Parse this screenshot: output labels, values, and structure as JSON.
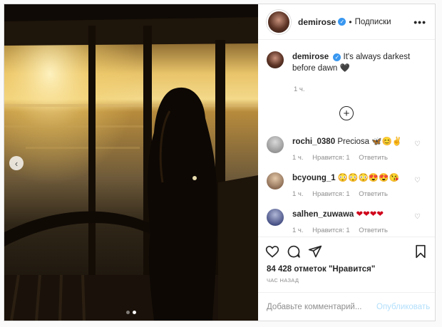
{
  "post": {
    "author": "demirose",
    "follow_label": "Подписки",
    "more_label": "•••",
    "caption": "It's always darkest before dawn",
    "caption_emoji": "🖤",
    "caption_time": "1 ч.",
    "load_more_icon": "plus-circle-icon"
  },
  "comments": [
    {
      "user": "rochi_0380",
      "text": "Preciosa 🦋😊✌",
      "time": "1 ч.",
      "likes": "Нравится: 1",
      "reply": "Ответить",
      "avatar": "gray"
    },
    {
      "user": "bcyoung_1",
      "text": "😳😳😳😍😍😘",
      "time": "1 ч.",
      "likes": "Нравится: 1",
      "reply": "Ответить",
      "avatar": "warm"
    },
    {
      "user": "salhen_zuwawa",
      "text": "❤❤❤❤",
      "time": "1 ч.",
      "likes": "Нравится: 1",
      "reply": "Ответить",
      "avatar": "navy"
    }
  ],
  "actions": {
    "like_icon": "heart-icon",
    "comment_icon": "comment-icon",
    "share_icon": "share-icon",
    "save_icon": "bookmark-icon"
  },
  "likes_text": "84 428 отметок \"Нравится\"",
  "posted_ago": "час назад",
  "add_comment": {
    "placeholder": "Добавьте комментарий...",
    "publish": "Опубликовать"
  },
  "carousel": {
    "current": 2,
    "total": 2
  },
  "colors": {
    "verified": "#3897f0",
    "publish_disabled": "#b2dffc",
    "meta": "#8e8e8e"
  }
}
